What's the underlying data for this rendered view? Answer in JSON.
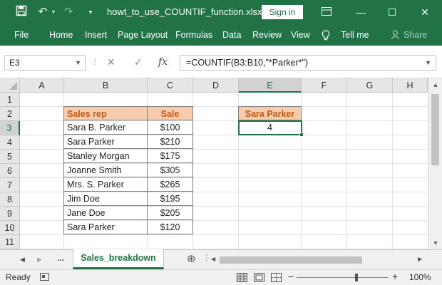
{
  "titlebar": {
    "file_name": "howt_to_use_COUNTIF_function.xlsx...",
    "sign_in": "Sign in",
    "save_icon": "save-icon",
    "undo_icon": "undo-icon",
    "redo_icon": "redo-icon",
    "customize_icon": "customize-toolbar-icon"
  },
  "ribbon": {
    "tabs": [
      "File",
      "Home",
      "Insert",
      "Page Layout",
      "Formulas",
      "Data",
      "Review",
      "View"
    ],
    "tell_me": "Tell me",
    "share": "Share"
  },
  "formula_bar": {
    "name_box": "E3",
    "cancel_symbol": "✕",
    "enter_symbol": "✓",
    "fx_symbol": "fx",
    "formula": "=COUNTIF(B3:B10,\"*Parker*\")"
  },
  "grid": {
    "columns": [
      "A",
      "B",
      "C",
      "D",
      "E",
      "F",
      "G",
      "H"
    ],
    "rows": [
      "1",
      "2",
      "3",
      "4",
      "5",
      "6",
      "7",
      "8",
      "9",
      "10",
      "11"
    ],
    "selected_column": "E",
    "selected_row": "3"
  },
  "sales_table": {
    "header": [
      "Sales rep",
      "Sale"
    ],
    "rows": [
      [
        "Sara B. Parker",
        "$100"
      ],
      [
        "Sara Parker",
        "$210"
      ],
      [
        "Stanley Morgan",
        "$175"
      ],
      [
        "Joanne Smith",
        "$305"
      ],
      [
        "Mrs. S. Parker",
        "$265"
      ],
      [
        "Jim Doe",
        "$195"
      ],
      [
        "Jane Doe",
        "$205"
      ],
      [
        "Sara Parker",
        "$120"
      ]
    ]
  },
  "result": {
    "label": "Sara Parker",
    "value": "4"
  },
  "sheets": {
    "more": "...",
    "active": "Sales_breakdown",
    "add": "⊕"
  },
  "status": {
    "ready": "Ready",
    "zoom": "100%",
    "zoom_minus": "−",
    "zoom_plus": "+"
  },
  "colors": {
    "excel_green": "#217346",
    "header_fill": "#f8cbad",
    "header_text": "#c55a11"
  }
}
